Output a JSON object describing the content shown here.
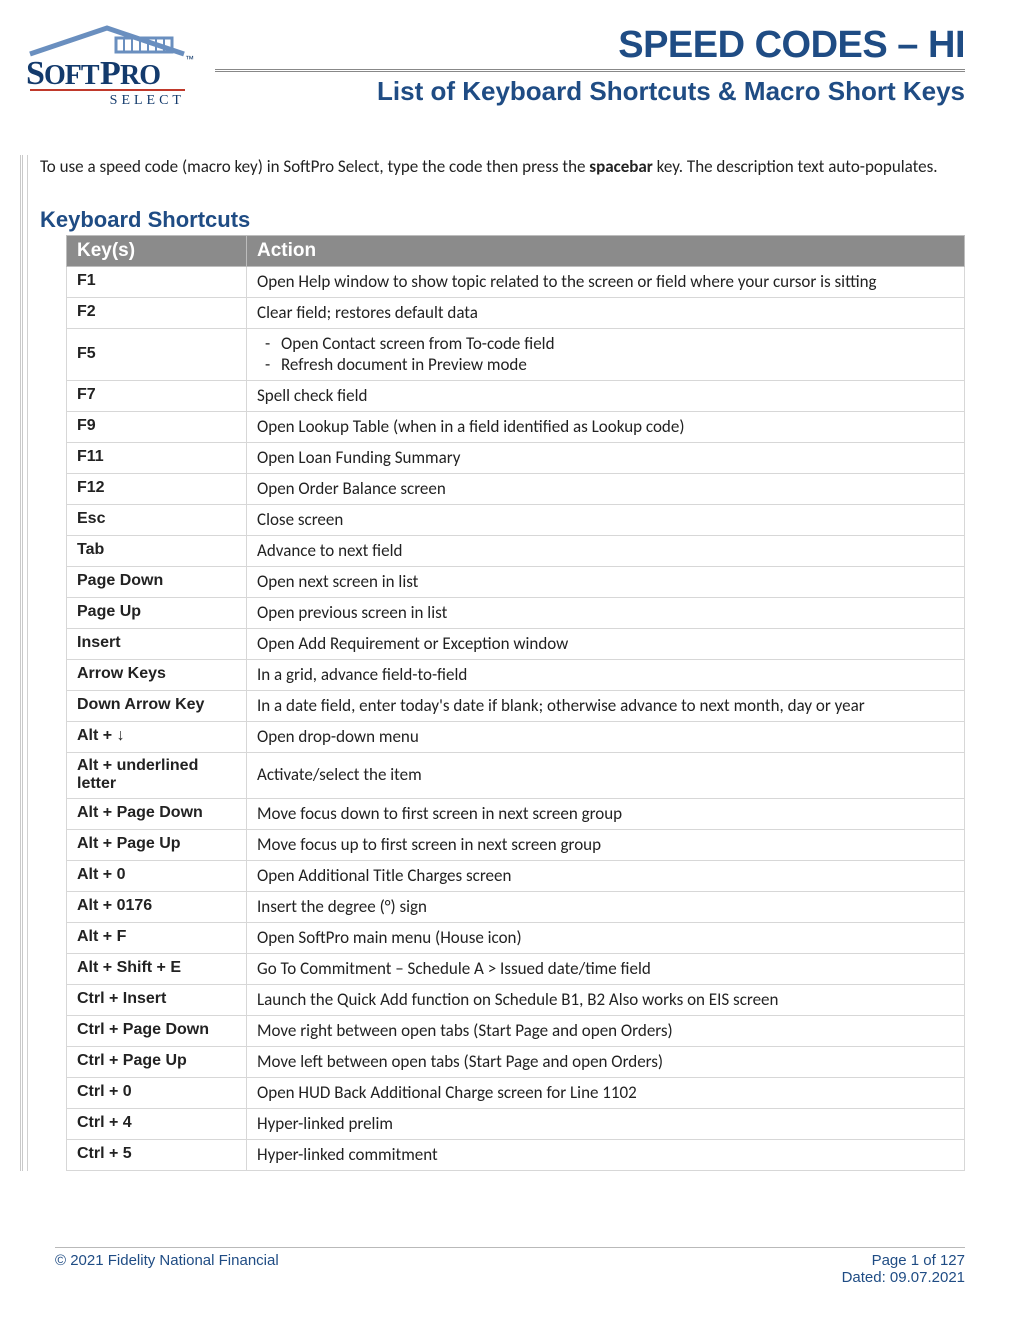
{
  "header": {
    "logo_main": "SOFTPRO",
    "logo_sub": "SELECT",
    "title": "SPEED CODES – HI",
    "subtitle": "List of Keyboard Shortcuts & Macro Short Keys"
  },
  "intro": {
    "pre": "To use a speed code (macro key) in SoftPro Select, type the code then press the ",
    "bold": "spacebar",
    "post": " key.  The description text auto-populates."
  },
  "section_title": "Keyboard Shortcuts",
  "table": {
    "col_key": "Key(s)",
    "col_action": "Action",
    "rows": [
      {
        "key": "F1",
        "action": "Open Help window to show topic related to the screen or field where your cursor is sitting"
      },
      {
        "key": "F2",
        "action": "Clear field; restores default data"
      },
      {
        "key": "F5",
        "list": [
          "Open Contact screen from To-code field",
          "Refresh document in Preview mode"
        ]
      },
      {
        "key": "F7",
        "action": "Spell check field"
      },
      {
        "key": "F9",
        "action": "Open Lookup Table (when in a field identified as Lookup code)"
      },
      {
        "key": "F11",
        "action": "Open Loan Funding Summary"
      },
      {
        "key": "F12",
        "action": "Open Order Balance screen"
      },
      {
        "key": "Esc",
        "action": "Close screen"
      },
      {
        "key": "Tab",
        "action": "Advance to next field"
      },
      {
        "key": "Page Down",
        "action": "Open next screen in list"
      },
      {
        "key": "Page Up",
        "action": "Open previous screen in list"
      },
      {
        "key": "Insert",
        "action": "Open Add Requirement or Exception window"
      },
      {
        "key": "Arrow Keys",
        "action": "In a grid, advance field-to-field"
      },
      {
        "key": "Down Arrow Key",
        "action": "In a date field, enter today's date if blank; otherwise advance to next month, day or year"
      },
      {
        "key": "Alt + ↓",
        "action": "Open drop-down menu"
      },
      {
        "key": "Alt + underlined letter",
        "action": "Activate/select the item"
      },
      {
        "key": "Alt + Page Down",
        "action": "Move focus down to first screen in next screen group"
      },
      {
        "key": "Alt + Page Up",
        "action": "Move focus up to first screen in next screen group"
      },
      {
        "key": "Alt + 0",
        "action": "Open Additional Title Charges screen"
      },
      {
        "key": "Alt + 0176",
        "action": "Insert the degree (°) sign"
      },
      {
        "key": "Alt + F",
        "action": "Open SoftPro main menu (House icon)"
      },
      {
        "key": "Alt + Shift + E",
        "action": "Go To Commitment – Schedule A > Issued date/time field"
      },
      {
        "key": "Ctrl + Insert",
        "action": "Launch the Quick Add function on Schedule B1, B2  Also works on EIS screen"
      },
      {
        "key": "Ctrl + Page Down",
        "action": "Move right between open tabs (Start Page and open Orders)"
      },
      {
        "key": "Ctrl + Page Up",
        "action": "Move left between open tabs (Start Page and open Orders)"
      },
      {
        "key": "Ctrl + 0",
        "action": "Open HUD Back Additional Charge screen for Line 1102"
      },
      {
        "key": "Ctrl + 4",
        "action": "Hyper-linked prelim"
      },
      {
        "key": "Ctrl + 5",
        "action": "Hyper-linked commitment"
      }
    ]
  },
  "footer": {
    "copyright": "© 2021 Fidelity National Financial",
    "page": "Page 1 of 127",
    "dated": "Dated: 09.07.2021"
  }
}
